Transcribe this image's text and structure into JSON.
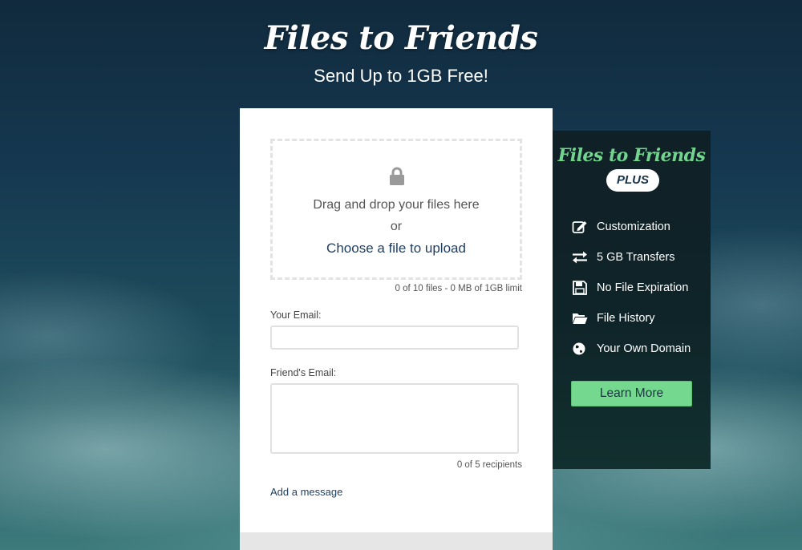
{
  "header": {
    "brand_title": "Files to Friends",
    "subtitle": "Send Up to 1GB Free!"
  },
  "upload": {
    "dropzone_text": "Drag and drop your files here",
    "or_text": "or",
    "choose_link": "Choose a file to upload",
    "lock_icon": "lock-icon",
    "limit_text": "0 of 10 files - 0 MB of 1GB limit"
  },
  "form": {
    "your_email_label": "Your Email:",
    "your_email_value": "",
    "friends_email_label": "Friend's Email:",
    "friends_email_value": "",
    "recipients_text": "0 of 5 recipients",
    "add_message_link": "Add a message"
  },
  "plus": {
    "brand_title": "Files to Friends",
    "badge": "PLUS",
    "features": [
      {
        "label": "Customization",
        "icon": "edit-icon"
      },
      {
        "label": "5 GB Transfers",
        "icon": "transfer-arrows-icon"
      },
      {
        "label": "No File Expiration",
        "icon": "floppy-disk-icon"
      },
      {
        "label": "File History",
        "icon": "folder-open-icon"
      },
      {
        "label": "Your Own Domain",
        "icon": "globe-icon"
      }
    ],
    "cta_label": "Learn More"
  },
  "colors": {
    "accent_green": "#74d98f",
    "link_blue": "#1e3d5f",
    "panel_dark": "#102027"
  }
}
